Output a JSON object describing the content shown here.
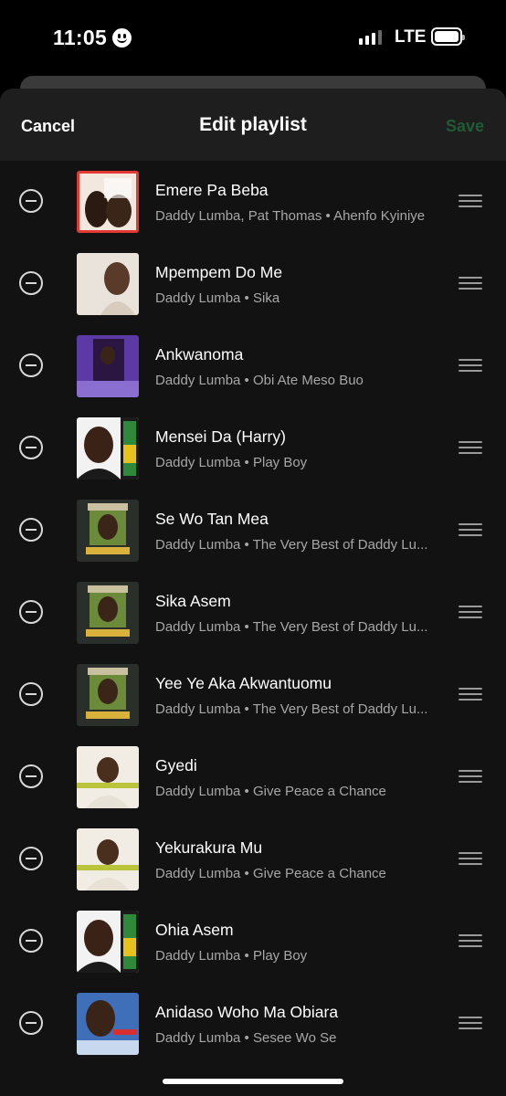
{
  "status_bar": {
    "time": "11:05",
    "network": "LTE"
  },
  "header": {
    "cancel_label": "Cancel",
    "title": "Edit playlist",
    "save_label": "Save"
  },
  "colors": {
    "save_disabled": "#1f5c34",
    "background": "#121212",
    "header_bg": "#1e1e1e",
    "subtitle": "#a7a7a7"
  },
  "tracks": [
    {
      "title": "Emere Pa Beba",
      "subtitle": "Daddy Lumba, Pat Thomas • Ahenfo Kyiniye"
    },
    {
      "title": "Mpempem Do Me",
      "subtitle": "Daddy Lumba • Sika"
    },
    {
      "title": "Ankwanoma",
      "subtitle": "Daddy Lumba • Obi Ate Meso Buo"
    },
    {
      "title": "Mensei Da (Harry)",
      "subtitle": "Daddy Lumba • Play Boy"
    },
    {
      "title": "Se Wo Tan Mea",
      "subtitle": "Daddy Lumba • The Very Best of Daddy Lu..."
    },
    {
      "title": "Sika Asem",
      "subtitle": "Daddy Lumba • The Very Best of Daddy Lu..."
    },
    {
      "title": "Yee Ye Aka Akwantuomu",
      "subtitle": "Daddy Lumba • The Very Best of Daddy Lu..."
    },
    {
      "title": "Gyedi",
      "subtitle": "Daddy Lumba • Give Peace a Chance"
    },
    {
      "title": "Yekurakura Mu",
      "subtitle": "Daddy Lumba • Give Peace a Chance"
    },
    {
      "title": "Ohia Asem",
      "subtitle": "Daddy Lumba • Play Boy"
    },
    {
      "title": "Anidaso Woho Ma Obiara",
      "subtitle": "Daddy Lumba • Sesee Wo Se"
    }
  ]
}
